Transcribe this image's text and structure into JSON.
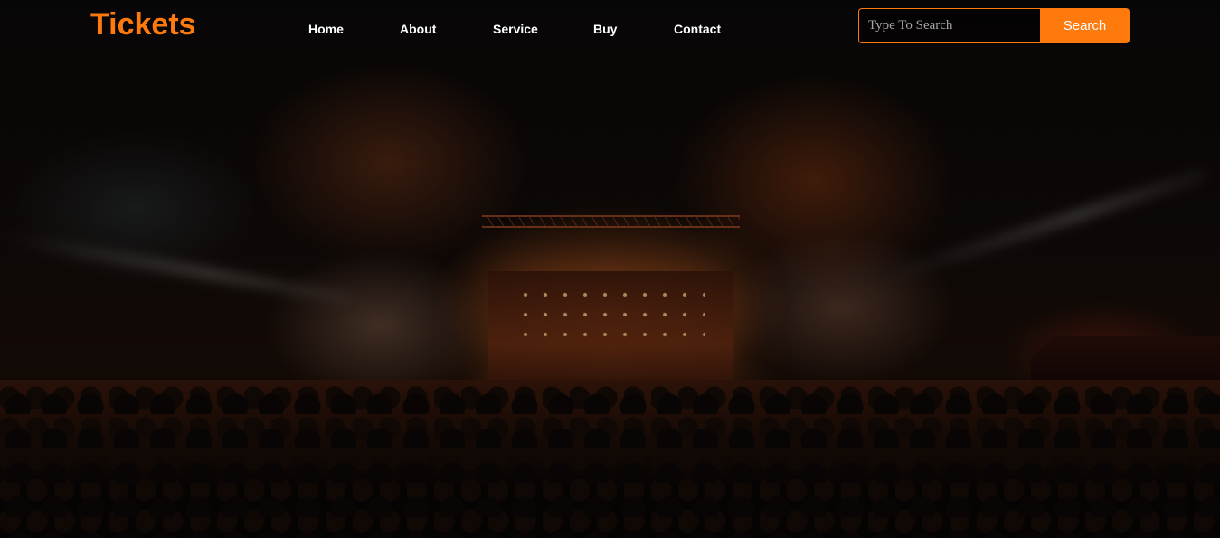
{
  "header": {
    "logo": "Tickets",
    "nav": [
      {
        "label": "Home"
      },
      {
        "label": "About"
      },
      {
        "label": "Service"
      },
      {
        "label": "Buy"
      },
      {
        "label": "Contact"
      }
    ],
    "search": {
      "placeholder": "Type To Search",
      "value": "",
      "button_label": "Search"
    }
  },
  "colors": {
    "accent": "#ff7a0d",
    "nav_text": "#ffffff",
    "background": "#050404"
  }
}
